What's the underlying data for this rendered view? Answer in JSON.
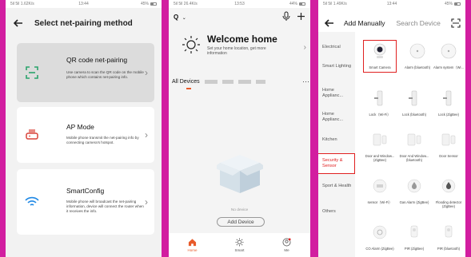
{
  "phone1": {
    "status": {
      "left": "5il 5il 1.62K/s",
      "time": "13:44",
      "right": "45%"
    },
    "title": "Select net-pairing method",
    "options": [
      {
        "title": "QR code net-pairing",
        "desc": "Use camera to scan the QR code on the mobile phone which contains net-pairing info."
      },
      {
        "title": "AP Mode",
        "desc": "Mobile phone transmit the net-pairing info by connecting camera's hotspot."
      },
      {
        "title": "SmartConfig",
        "desc": "Mobile phone will broadcast the net-pairing information, device will connect the router when it receives the info."
      }
    ]
  },
  "phone2": {
    "status": {
      "left": "5il 5il 26.4K/s",
      "time": "13:53",
      "right": "44%"
    },
    "home": "Q",
    "welcome_title": "Welcome home",
    "welcome_sub": "Set your home location, get more information",
    "devices_label": "All Devices",
    "no_device": "No device",
    "add_device": "Add Device",
    "tabs": [
      "Home",
      "Smart",
      "Me"
    ]
  },
  "phone3": {
    "status": {
      "left": "5il 5il 1.49K/s",
      "time": "13:44",
      "right": "45%"
    },
    "tab_manual": "Add Manually",
    "tab_search": "Search Device",
    "categories": [
      "Electrical",
      "Smart Lighting",
      "Home Applianc...",
      "Home Applianc...",
      "Kitchen",
      "Security & Sensor",
      "Sport & Health",
      "Others"
    ],
    "devices": [
      [
        "Smart Camera",
        "Alarm (bluetooth)",
        "Alarm system（Wi..."
      ],
      [
        "Lock（Wi-Fi）",
        "Lock (bluetooth)",
        "Lock (ZigBee)"
      ],
      [
        "Door and Window... (ZigBee)",
        "Door And Window... (bluetooth)",
        "Door Sensor"
      ],
      [
        "sensor（Wi-Fi）",
        "Gas Alarm (ZigBee)",
        "Flooding detector (ZigBee)"
      ],
      [
        "CO Alarm (ZigBee)",
        "PIR (ZigBee)",
        "PIR (bluetooth)"
      ]
    ]
  },
  "colors": {
    "accent": "#e85a2a",
    "selected_red": "#e02020",
    "qr_green": "#2aa36b",
    "ap_red": "#d9443a",
    "wifi_blue": "#1e88e5"
  }
}
